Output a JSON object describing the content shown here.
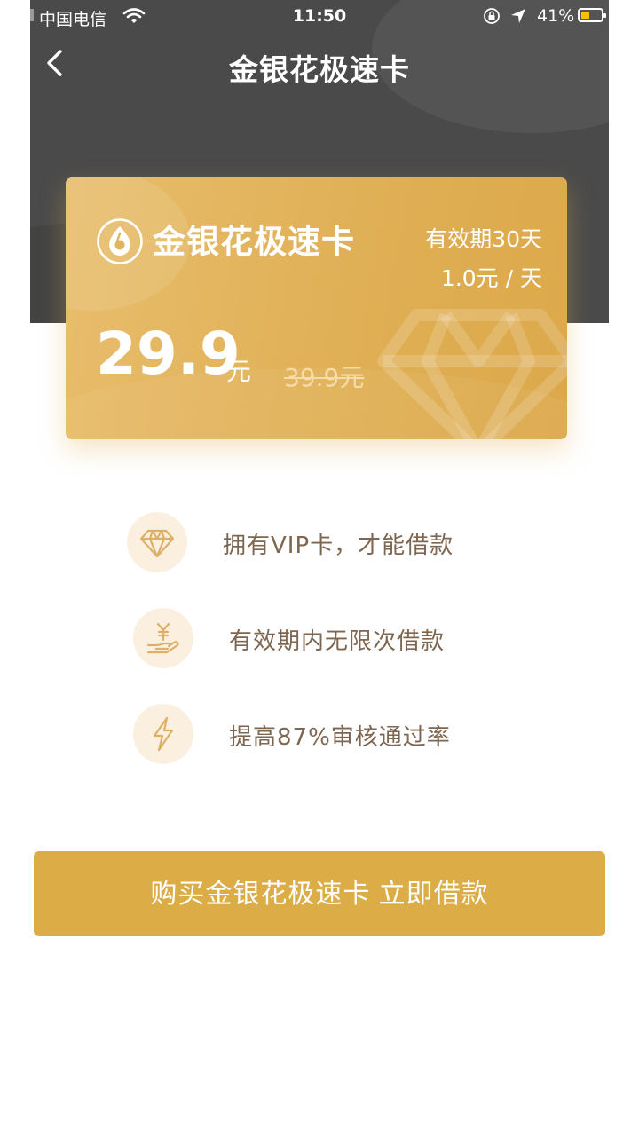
{
  "status_bar": {
    "carrier": "中国电信",
    "time": "11:50",
    "battery_percent": "41%",
    "battery_level": 0.41,
    "icons": [
      "signal-icon",
      "wifi-icon",
      "orientation-lock-icon",
      "location-arrow-icon",
      "battery-icon"
    ]
  },
  "nav": {
    "title": "金银花极速卡",
    "back_icon": "chevron-left-icon"
  },
  "card": {
    "name": "金银花极速卡",
    "validity": "有效期30天",
    "daily_price": "1.0元 / 天",
    "price": "29.9",
    "price_unit": "元",
    "original_price": "39.9元",
    "logo_icon": "honeysuckle-logo-icon",
    "watermark_icon": "diamond-icon"
  },
  "features": [
    {
      "icon": "diamond-icon",
      "label": "拥有VIP卡，才能借款"
    },
    {
      "icon": "yuan-hand-icon",
      "label": "有效期内无限次借款"
    },
    {
      "icon": "lightning-icon",
      "label": "提高87%审核通过率"
    }
  ],
  "cta": {
    "label": "购买金银花极速卡 立即借款"
  },
  "colors": {
    "header_bg": "#4a4a4a",
    "card_gold": "#e0b056",
    "accent_gold": "#dcad47",
    "icon_bg": "#fbf0df",
    "icon_stroke": "#deb067",
    "feature_text": "#7e6650"
  }
}
